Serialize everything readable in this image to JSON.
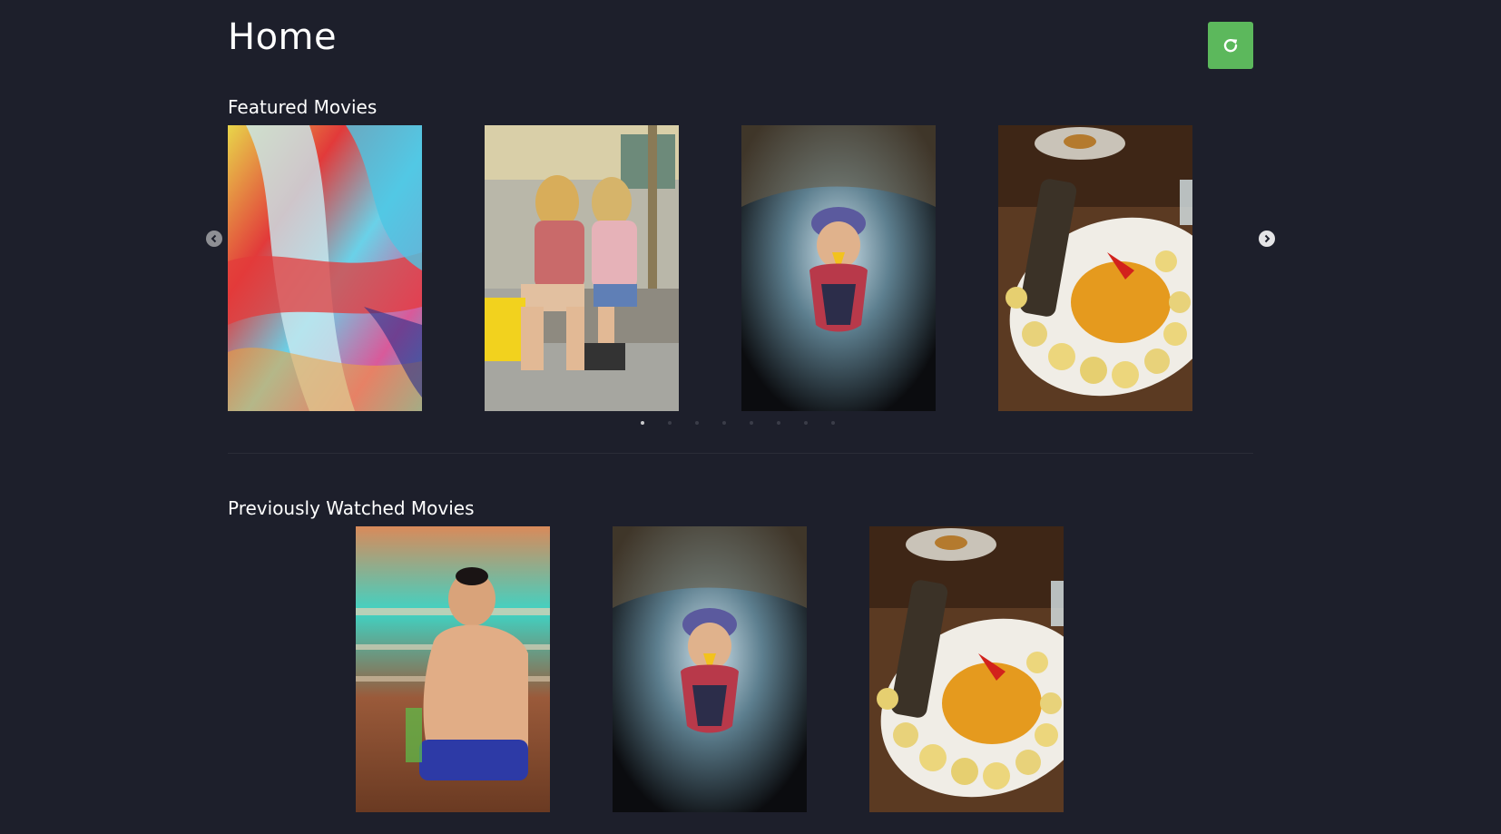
{
  "page": {
    "title": "Home"
  },
  "header": {
    "refresh_icon": "refresh-icon",
    "refresh_color": "#5cb85c"
  },
  "featured": {
    "heading": "Featured Movies",
    "posters": [
      {
        "icon": "abstract-paint-poster"
      },
      {
        "icon": "girls-on-phones-poster"
      },
      {
        "icon": "swimmer-underwater-poster"
      },
      {
        "icon": "food-plate-poster"
      }
    ],
    "prev_icon": "chevron-left-icon",
    "next_icon": "chevron-right-icon",
    "indicator_count": 8,
    "active_indicator": 1
  },
  "watched": {
    "heading": "Previously Watched Movies",
    "posters": [
      {
        "icon": "sumo-wrestler-poster"
      },
      {
        "icon": "swimmer-underwater-poster"
      },
      {
        "icon": "food-plate-poster"
      }
    ]
  },
  "colors": {
    "background": "#1d1f2b",
    "accent": "#5cb85c"
  }
}
